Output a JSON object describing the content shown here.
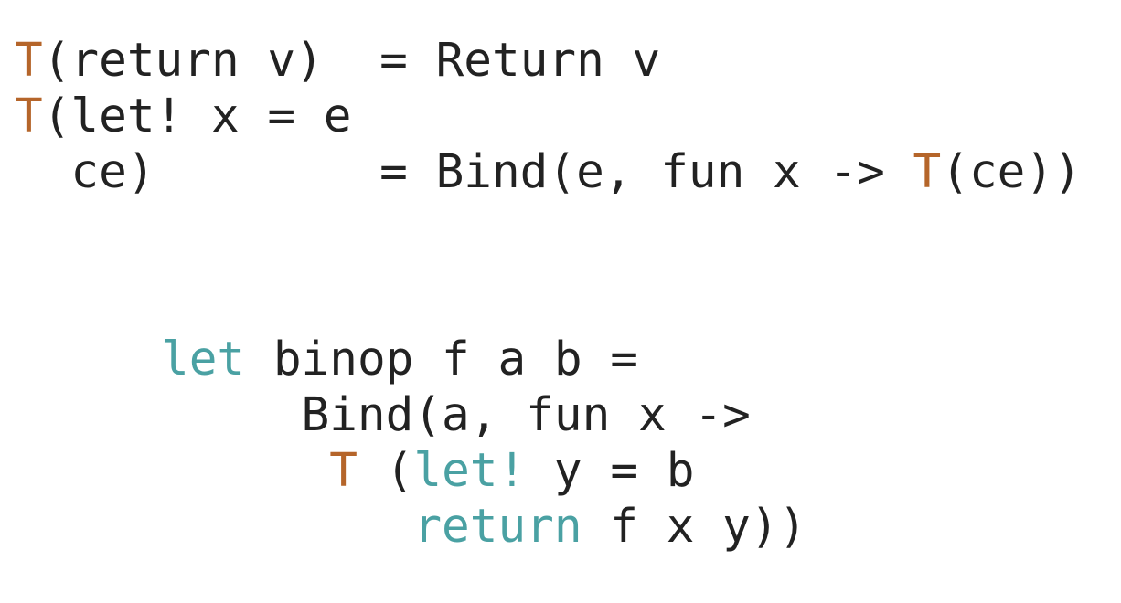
{
  "colors": {
    "translation_operator": "#B5652A",
    "keyword": "#4AA1A3",
    "text": "#222222",
    "background": "#FFFFFF"
  },
  "rules": [
    {
      "head": "T",
      "mid": "(return v)  = Return v"
    },
    {
      "head": "T",
      "mid": "(let! x = e"
    },
    {
      "mid": "  ce)        = Bind(e, fun x -> ",
      "op": "T",
      "tail": "(ce))"
    }
  ],
  "example": [
    {
      "kw": "let",
      "mid": " binop f a b ="
    },
    {
      "mid": "     Bind(a, fun x ->"
    },
    {
      "lead": "      ",
      "op": "T",
      "mid": " (",
      "kw": "let!",
      "tail": " y = b"
    },
    {
      "lead": "         ",
      "kw": "return",
      "tail": " f x y))"
    }
  ]
}
